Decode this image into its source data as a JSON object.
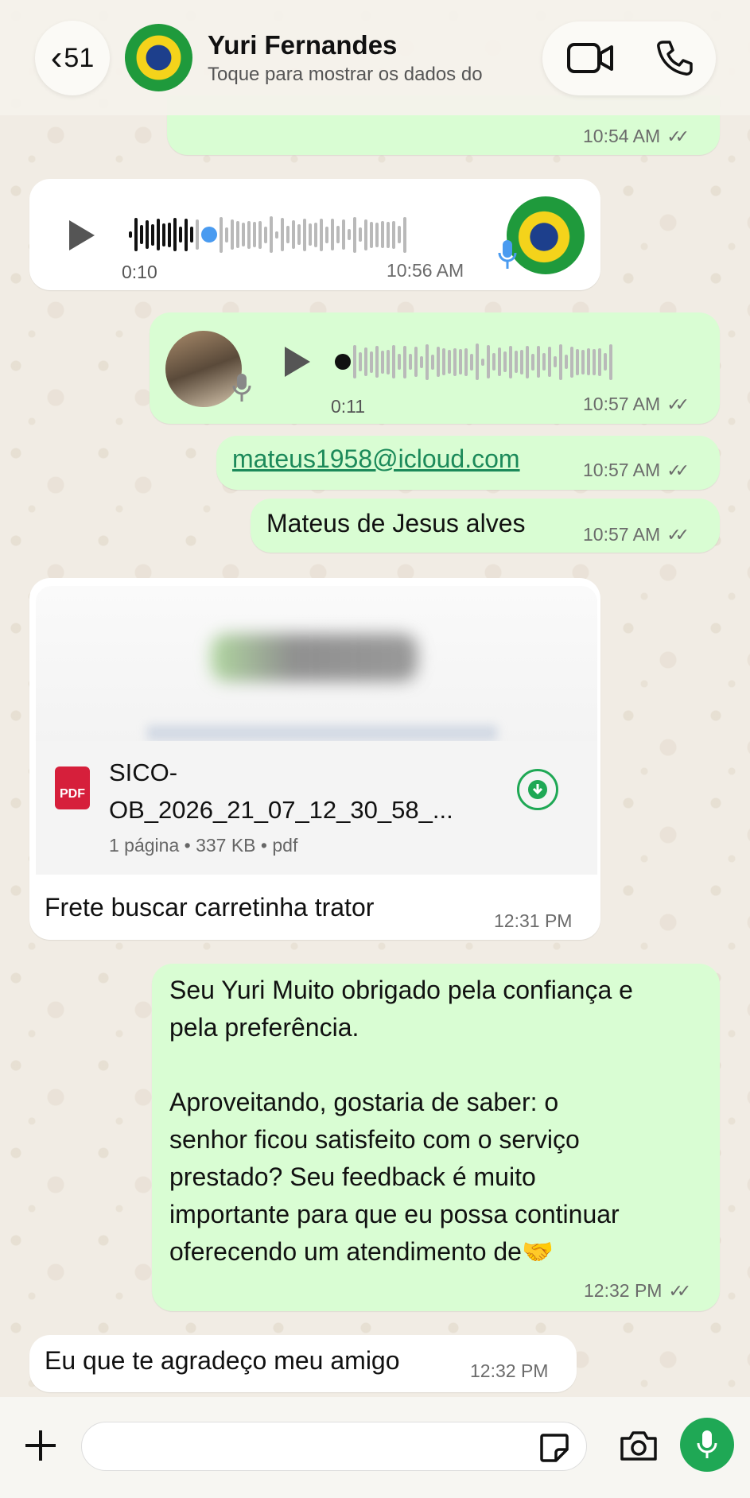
{
  "header": {
    "back_count": "51",
    "contact_name": "Yuri Fernandes",
    "contact_subtitle": "Toque para mostrar os dados do"
  },
  "messages": {
    "m0": {
      "time": "10:54 AM"
    },
    "m1": {
      "duration": "0:10",
      "time": "10:56 AM"
    },
    "m2": {
      "duration": "0:11",
      "time": "10:57 AM"
    },
    "m3": {
      "text": "mateus1958@icloud.com",
      "time": "10:57 AM"
    },
    "m4": {
      "text": "Mateus de Jesus alves",
      "time": "10:57 AM"
    },
    "m5": {
      "file_name_line1": "SICO-",
      "file_name_line2": "OB_2026_21_07_12_30_58_...",
      "file_meta": "1 página • 337 KB • pdf",
      "pdf_badge": "PDF",
      "caption": "Frete buscar carretinha trator",
      "time": "12:31 PM"
    },
    "m6": {
      "lines": [
        "Seu Yuri Muito obrigado pela confiança e",
        "pela preferência.",
        "",
        "Aproveitando, gostaria de saber: o",
        "senhor ficou satisfeito com o serviço",
        "prestado? Seu feedback é muito",
        "importante para que eu possa continuar",
        "oferecendo um atendimento de🤝"
      ],
      "time": "12:32 PM"
    },
    "m7": {
      "text": "Eu que te agradeço meu amigo",
      "time": "12:32 PM"
    }
  },
  "icons": {
    "video": "video-camera-icon",
    "phone": "phone-icon",
    "plus": "plus-icon",
    "sticker": "sticker-icon",
    "camera": "camera-icon",
    "mic": "microphone-icon"
  },
  "colors": {
    "outgoing_bubble": "#d9fdd3",
    "incoming_bubble": "#ffffff",
    "accent_green": "#1fa855",
    "voice_dot": "#4a9bf0",
    "pdf_red": "#d61f3b"
  }
}
